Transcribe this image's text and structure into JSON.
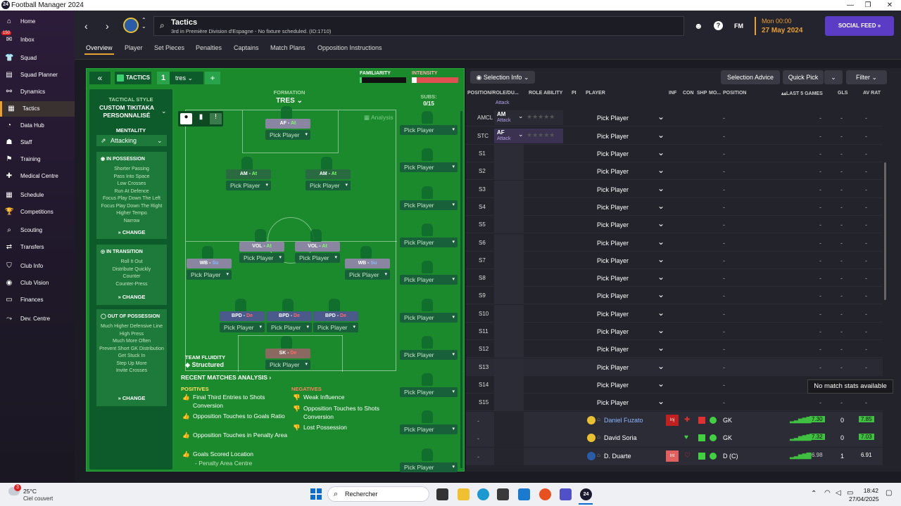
{
  "window": {
    "title": "Football Manager 2024",
    "icon_text": "24"
  },
  "sidebar": {
    "inbox_badge": "150",
    "items": [
      {
        "label": "Home",
        "icon": "home-icon",
        "glyph": "⌂"
      },
      {
        "label": "Inbox",
        "icon": "inbox-icon",
        "glyph": "✉"
      },
      {
        "label": "Squad",
        "icon": "squad-icon",
        "glyph": "👕"
      },
      {
        "label": "Squad Planner",
        "icon": "planner-icon",
        "glyph": "▤"
      },
      {
        "label": "Dynamics",
        "icon": "dynamics-icon",
        "glyph": "⚯"
      },
      {
        "label": "Tactics",
        "icon": "tactics-icon",
        "glyph": "▦"
      },
      {
        "label": "Data Hub",
        "icon": "datahub-icon",
        "glyph": "◔"
      },
      {
        "label": "Staff",
        "icon": "staff-icon",
        "glyph": "☗"
      },
      {
        "label": "Training",
        "icon": "training-icon",
        "glyph": "⚑"
      },
      {
        "label": "Medical Centre",
        "icon": "medical-icon",
        "glyph": "✚"
      },
      {
        "label": "Schedule",
        "icon": "schedule-icon",
        "glyph": "▦"
      },
      {
        "label": "Competitions",
        "icon": "trophy-icon",
        "glyph": "🏆"
      },
      {
        "label": "Scouting",
        "icon": "scouting-icon",
        "glyph": "⌕"
      },
      {
        "label": "Transfers",
        "icon": "transfers-icon",
        "glyph": "⇄"
      },
      {
        "label": "Club Info",
        "icon": "shield-icon",
        "glyph": "⛉"
      },
      {
        "label": "Club Vision",
        "icon": "vision-icon",
        "glyph": "◉"
      },
      {
        "label": "Finances",
        "icon": "finances-icon",
        "glyph": "▭"
      },
      {
        "label": "Dev. Centre",
        "icon": "dev-icon",
        "glyph": "⤳"
      }
    ]
  },
  "header": {
    "title": "Tactics",
    "subtitle": "3rd in Première Division d'Espagne - No fixture scheduled. (ID:1710)",
    "fm": "FM",
    "time": "Mon 00:00",
    "date": "27 May 2024",
    "social": "SOCIAL FEED"
  },
  "tabs": [
    "Overview",
    "Player",
    "Set Pieces",
    "Penalties",
    "Captains",
    "Match Plans",
    "Opposition Instructions"
  ],
  "tactic_bar": {
    "label": "TACTICS",
    "slot": "1",
    "name": "tres",
    "add": "+",
    "familiarity": "FAMILIARITY",
    "intensity": "INTENSITY",
    "familiarity_level": 0.05,
    "intensity_level": 0.1
  },
  "style": {
    "heading": "TACTICAL STYLE",
    "name": "CUSTOM TIKITAKA PERSONNALISÉ",
    "mentality_label": "MENTALITY",
    "mentality": "Attacking"
  },
  "in_possession": {
    "title": "IN POSSESSION",
    "items": [
      "Shorter Passing",
      "Pass Into Space",
      "Low Crosses",
      "Run At Defence",
      "Focus Play Down The Left",
      "Focus Play Down The Right",
      "Higher Tempo",
      "Narrow"
    ],
    "change": "CHANGE"
  },
  "in_transition": {
    "title": "IN TRANSITION",
    "items": [
      "Roll It Out",
      "Distribute Quickly",
      "Counter",
      "Counter-Press"
    ],
    "change": "CHANGE"
  },
  "out_possession": {
    "title": "OUT OF POSSESSION",
    "items": [
      "Much Higher Defensive Line",
      "High Press",
      "Much More Often",
      "Prevent Short GK Distribution",
      "Get Stuck In",
      "Step Up More",
      "Invite Crosses"
    ],
    "change": "CHANGE"
  },
  "formation": {
    "label": "FORMATION",
    "name": "TRES",
    "subs_label": "SUBS:",
    "subs_count": "0/15",
    "analysis": "Analysis",
    "pick": "Pick Player",
    "roles": [
      {
        "role": "AF",
        "duty": "At"
      },
      {
        "role": "AM",
        "duty": "At"
      },
      {
        "role": "AM",
        "duty": "At"
      },
      {
        "role": "VOL",
        "duty": "At"
      },
      {
        "role": "VOL",
        "duty": "At"
      },
      {
        "role": "WB",
        "duty": "Su"
      },
      {
        "role": "WB",
        "duty": "Su"
      },
      {
        "role": "BPD",
        "duty": "De"
      },
      {
        "role": "BPD",
        "duty": "De"
      },
      {
        "role": "BPD",
        "duty": "De"
      },
      {
        "role": "SK",
        "duty": "De"
      }
    ]
  },
  "fluidity": {
    "label": "TEAM FLUIDITY",
    "value": "Structured"
  },
  "analysis": {
    "title": "RECENT MATCHES ANALYSIS",
    "positives_label": "POSITIVES",
    "negatives_label": "NEGATIVES",
    "positives": [
      "Final Third Entries to Shots Conversion",
      "Opposition Touches to Goals Ratio",
      "Opposition Touches in Penalty Area",
      "Goals Scored Location"
    ],
    "positives_sub": "- Penalty Area Centre",
    "negatives": [
      "Weak Influence",
      "Opposition Touches to Shots Conversion",
      "Lost Possession"
    ]
  },
  "right": {
    "selection_info": "Selection Info",
    "selection_advice": "Selection Advice",
    "quick_pick": "Quick Pick",
    "filter": "Filter",
    "columns": [
      "POSITION/ROLE/DU...",
      "ROLE ABILITY",
      "PI",
      "PLAYER",
      "INF",
      "CON",
      "SHP",
      "MO...",
      "POSITION",
      "LAST 5 GAMES",
      "GLS",
      "AV RAT"
    ],
    "top_rows": [
      {
        "pos": "AMCL",
        "role": "AM",
        "duty": "Attack"
      },
      {
        "pos": "STC",
        "role": "AF",
        "duty": "Attack"
      }
    ],
    "subs": [
      "S1",
      "S2",
      "S3",
      "S4",
      "S5",
      "S6",
      "S7",
      "S8",
      "S9",
      "S10",
      "S11",
      "S12",
      "S13",
      "S14",
      "S15"
    ],
    "partial_duty": "Attack",
    "pick": "Pick Player",
    "tooltip": "No match stats available",
    "players": [
      {
        "name": "Daniel Fuzato",
        "tag": "Inj",
        "pos": "GK",
        "form": "7.30",
        "gls": "0",
        "rat": "7.85"
      },
      {
        "name": "David Soria",
        "tag": "",
        "pos": "GK",
        "form": "7.32",
        "gls": "0",
        "rat": "7.03"
      },
      {
        "name": "D. Duarte",
        "tag": "Int",
        "pos": "D (C)",
        "form": "6.98",
        "gls": "1",
        "rat": "6.91"
      }
    ]
  },
  "taskbar": {
    "temp": "25°C",
    "weather": "Ciel couvert",
    "search": "Rechercher",
    "time": "18:42",
    "date": "27/04/2025",
    "notif": "3"
  }
}
